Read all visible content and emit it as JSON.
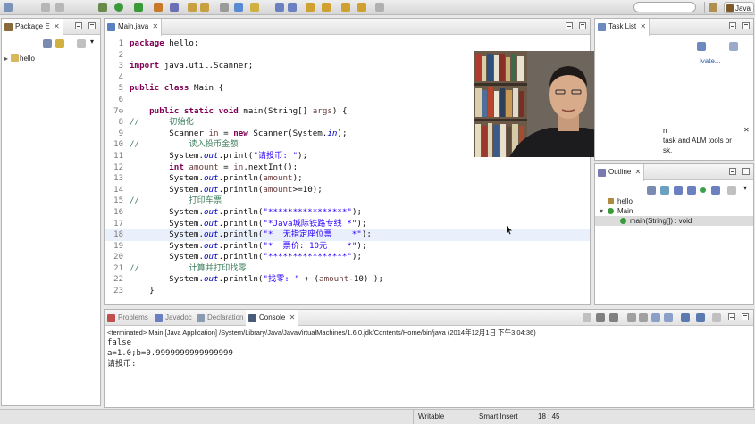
{
  "colors": {
    "keyword": "#7f0055",
    "comment": "#3f7f5f",
    "string": "#2a00ff",
    "field": "#0000c0"
  },
  "toolbar": {
    "perspective_label": "Java"
  },
  "package_explorer": {
    "tab_label": "Package E",
    "tree": [
      {
        "label": "hello",
        "icon": "project-folder-icon"
      }
    ]
  },
  "editor": {
    "tab_label": "Main.java",
    "current_line": 18,
    "lines": [
      {
        "n": "1",
        "segs": [
          {
            "t": "package",
            "c": "kw"
          },
          {
            "t": " hello;"
          }
        ]
      },
      {
        "n": "2",
        "segs": []
      },
      {
        "n": "3",
        "segs": [
          {
            "t": "import",
            "c": "kw"
          },
          {
            "t": " java.util.Scanner;"
          }
        ]
      },
      {
        "n": "4",
        "segs": []
      },
      {
        "n": "5",
        "segs": [
          {
            "t": "public",
            "c": "kw"
          },
          {
            "t": " "
          },
          {
            "t": "class",
            "c": "kw"
          },
          {
            "t": " Main {"
          }
        ]
      },
      {
        "n": "6",
        "segs": []
      },
      {
        "n": "7⊖",
        "segs": [
          {
            "t": "    "
          },
          {
            "t": "public",
            "c": "kw"
          },
          {
            "t": " "
          },
          {
            "t": "static",
            "c": "kw"
          },
          {
            "t": " "
          },
          {
            "t": "void",
            "c": "kw"
          },
          {
            "t": " main(String[] "
          },
          {
            "t": "args",
            "c": "var"
          },
          {
            "t": ") {"
          }
        ]
      },
      {
        "n": "8",
        "segs": [
          {
            "t": "//      初始化",
            "c": "cm"
          }
        ]
      },
      {
        "n": "9",
        "segs": [
          {
            "t": "        Scanner "
          },
          {
            "t": "in",
            "c": "var"
          },
          {
            "t": " = "
          },
          {
            "t": "new",
            "c": "kw"
          },
          {
            "t": " Scanner(System."
          },
          {
            "t": "in",
            "c": "fld"
          },
          {
            "t": ");"
          }
        ]
      },
      {
        "n": "10",
        "segs": [
          {
            "t": "//          读入投币金额",
            "c": "cm"
          }
        ]
      },
      {
        "n": "11",
        "segs": [
          {
            "t": "        System."
          },
          {
            "t": "out",
            "c": "fld"
          },
          {
            "t": ".print("
          },
          {
            "t": "\"请投币: \"",
            "c": "st"
          },
          {
            "t": ");"
          }
        ]
      },
      {
        "n": "12",
        "segs": [
          {
            "t": "        "
          },
          {
            "t": "int",
            "c": "kw"
          },
          {
            "t": " "
          },
          {
            "t": "amount",
            "c": "var"
          },
          {
            "t": " = "
          },
          {
            "t": "in",
            "c": "var"
          },
          {
            "t": ".nextInt();"
          }
        ]
      },
      {
        "n": "13",
        "segs": [
          {
            "t": "        System."
          },
          {
            "t": "out",
            "c": "fld"
          },
          {
            "t": ".println("
          },
          {
            "t": "amount",
            "c": "var"
          },
          {
            "t": ");"
          }
        ]
      },
      {
        "n": "14",
        "segs": [
          {
            "t": "        System."
          },
          {
            "t": "out",
            "c": "fld"
          },
          {
            "t": ".println("
          },
          {
            "t": "amount",
            "c": "var"
          },
          {
            "t": ">=10);"
          }
        ]
      },
      {
        "n": "15",
        "segs": [
          {
            "t": "//          打印车票",
            "c": "cm"
          }
        ]
      },
      {
        "n": "16",
        "segs": [
          {
            "t": "        System."
          },
          {
            "t": "out",
            "c": "fld"
          },
          {
            "t": ".println("
          },
          {
            "t": "\"****************\"",
            "c": "st"
          },
          {
            "t": ");"
          }
        ]
      },
      {
        "n": "17",
        "segs": [
          {
            "t": "        System."
          },
          {
            "t": "out",
            "c": "fld"
          },
          {
            "t": ".println("
          },
          {
            "t": "\"*Java城际铁路专线 *\"",
            "c": "st"
          },
          {
            "t": ");"
          }
        ]
      },
      {
        "n": "18",
        "segs": [
          {
            "t": "        System."
          },
          {
            "t": "out",
            "c": "fld"
          },
          {
            "t": ".println("
          },
          {
            "t": "\"*  无指定座位票    *\"",
            "c": "st"
          },
          {
            "t": ");"
          }
        ]
      },
      {
        "n": "19",
        "segs": [
          {
            "t": "        System."
          },
          {
            "t": "out",
            "c": "fld"
          },
          {
            "t": ".println("
          },
          {
            "t": "\"*  票价: 10元    *\"",
            "c": "st"
          },
          {
            "t": ");"
          }
        ]
      },
      {
        "n": "20",
        "segs": [
          {
            "t": "        System."
          },
          {
            "t": "out",
            "c": "fld"
          },
          {
            "t": ".println("
          },
          {
            "t": "\"****************\"",
            "c": "st"
          },
          {
            "t": ");"
          }
        ]
      },
      {
        "n": "21",
        "segs": [
          {
            "t": "//          计算并打印找零",
            "c": "cm"
          }
        ]
      },
      {
        "n": "22",
        "segs": [
          {
            "t": "        System."
          },
          {
            "t": "out",
            "c": "fld"
          },
          {
            "t": ".println("
          },
          {
            "t": "\"找零: \"",
            "c": "st"
          },
          {
            "t": " + ("
          },
          {
            "t": "amount",
            "c": "var"
          },
          {
            "t": "-10) );"
          }
        ]
      },
      {
        "n": "23",
        "segs": [
          {
            "t": "    }"
          }
        ]
      }
    ]
  },
  "task_list": {
    "tab_label": "Task List",
    "text_lines": [
      "n",
      "task and ALM tools or",
      "sk."
    ],
    "link_text": "ivate..."
  },
  "outline": {
    "tab_label": "Outline",
    "items": [
      {
        "label": "hello",
        "icon": "package-icon",
        "indent": 0,
        "selected": false
      },
      {
        "label": "Main",
        "icon": "class-icon",
        "indent": 0,
        "selected": false
      },
      {
        "label": "main(String[]) : void",
        "icon": "method-icon",
        "indent": 1,
        "selected": true
      }
    ]
  },
  "console": {
    "tabs": [
      {
        "label": "Problems",
        "icon": "problems-icon",
        "active": false
      },
      {
        "label": "Javadoc",
        "icon": "javadoc-icon",
        "active": false
      },
      {
        "label": "Declaration",
        "icon": "declaration-icon",
        "active": false
      },
      {
        "label": "Console",
        "icon": "console-icon",
        "active": true
      }
    ],
    "header": "<terminated> Main [Java Application] /System/Library/Java/JavaVirtualMachines/1.6.0.jdk/Contents/Home/bin/java (2014年12月1日 下午3:04:36)",
    "lines": [
      "false",
      "a=1.0;b=0.9999999999999999",
      "请投币:"
    ]
  },
  "statusbar": {
    "writable": "Writable",
    "insert_mode": "Smart Insert",
    "position": "18 : 45"
  }
}
